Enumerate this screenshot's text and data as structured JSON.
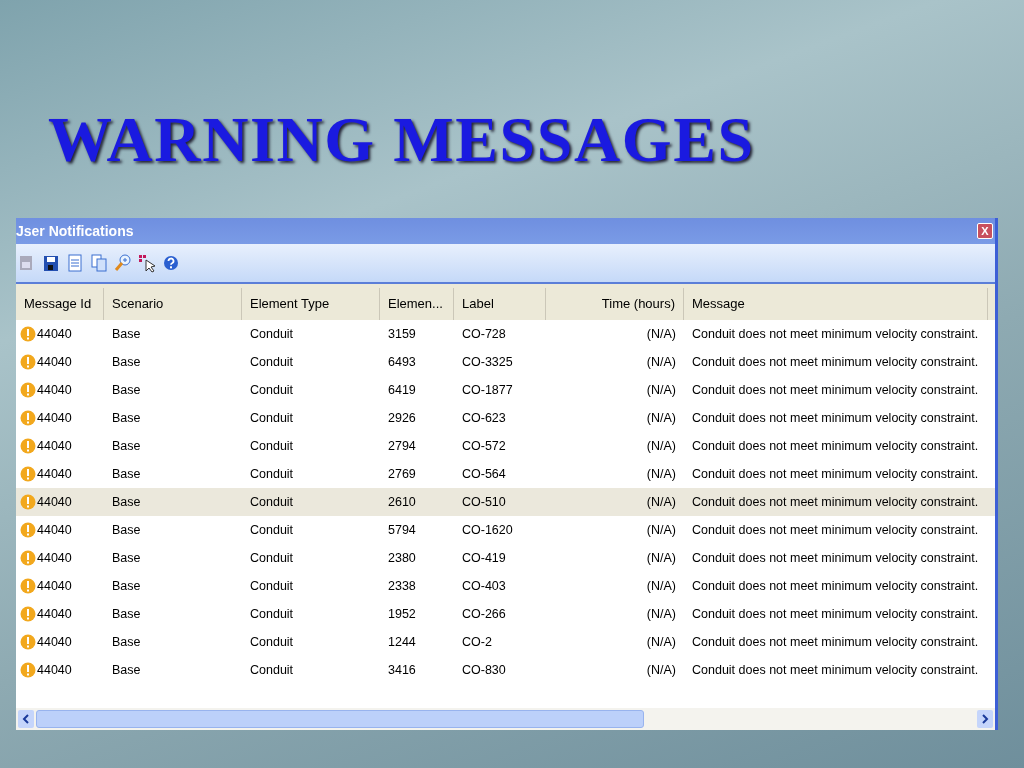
{
  "slide": {
    "title": "WARNING MESSAGES"
  },
  "window": {
    "title": "Jser Notifications",
    "close": "X"
  },
  "table": {
    "columns": [
      {
        "label": "Message Id"
      },
      {
        "label": "Scenario"
      },
      {
        "label": "Element Type"
      },
      {
        "label": "Elemen..."
      },
      {
        "label": "Label"
      },
      {
        "label": "Time (hours)"
      },
      {
        "label": "Message"
      }
    ],
    "rows": [
      {
        "cells": [
          "44040",
          "Base",
          "Conduit",
          "3159",
          "CO-728",
          "(N/A)",
          "Conduit does not meet minimum velocity constraint."
        ],
        "selected": false
      },
      {
        "cells": [
          "44040",
          "Base",
          "Conduit",
          "6493",
          "CO-3325",
          "(N/A)",
          "Conduit does not meet minimum velocity constraint."
        ],
        "selected": false
      },
      {
        "cells": [
          "44040",
          "Base",
          "Conduit",
          "6419",
          "CO-1877",
          "(N/A)",
          "Conduit does not meet minimum velocity constraint."
        ],
        "selected": false
      },
      {
        "cells": [
          "44040",
          "Base",
          "Conduit",
          "2926",
          "CO-623",
          "(N/A)",
          "Conduit does not meet minimum velocity constraint."
        ],
        "selected": false
      },
      {
        "cells": [
          "44040",
          "Base",
          "Conduit",
          "2794",
          "CO-572",
          "(N/A)",
          "Conduit does not meet minimum velocity constraint."
        ],
        "selected": false
      },
      {
        "cells": [
          "44040",
          "Base",
          "Conduit",
          "2769",
          "CO-564",
          "(N/A)",
          "Conduit does not meet minimum velocity constraint."
        ],
        "selected": false
      },
      {
        "cells": [
          "44040",
          "Base",
          "Conduit",
          "2610",
          "CO-510",
          "(N/A)",
          "Conduit does not meet minimum velocity constraint."
        ],
        "selected": true
      },
      {
        "cells": [
          "44040",
          "Base",
          "Conduit",
          "5794",
          "CO-1620",
          "(N/A)",
          "Conduit does not meet minimum velocity constraint."
        ],
        "selected": false
      },
      {
        "cells": [
          "44040",
          "Base",
          "Conduit",
          "2380",
          "CO-419",
          "(N/A)",
          "Conduit does not meet minimum velocity constraint."
        ],
        "selected": false
      },
      {
        "cells": [
          "44040",
          "Base",
          "Conduit",
          "2338",
          "CO-403",
          "(N/A)",
          "Conduit does not meet minimum velocity constraint."
        ],
        "selected": false
      },
      {
        "cells": [
          "44040",
          "Base",
          "Conduit",
          "1952",
          "CO-266",
          "(N/A)",
          "Conduit does not meet minimum velocity constraint."
        ],
        "selected": false
      },
      {
        "cells": [
          "44040",
          "Base",
          "Conduit",
          "1244",
          "CO-2",
          "(N/A)",
          "Conduit does not meet minimum velocity constraint."
        ],
        "selected": false
      },
      {
        "cells": [
          "44040",
          "Base",
          "Conduit",
          "3416",
          "CO-830",
          "(N/A)",
          "Conduit does not meet minimum velocity constraint."
        ],
        "selected": false
      }
    ]
  }
}
